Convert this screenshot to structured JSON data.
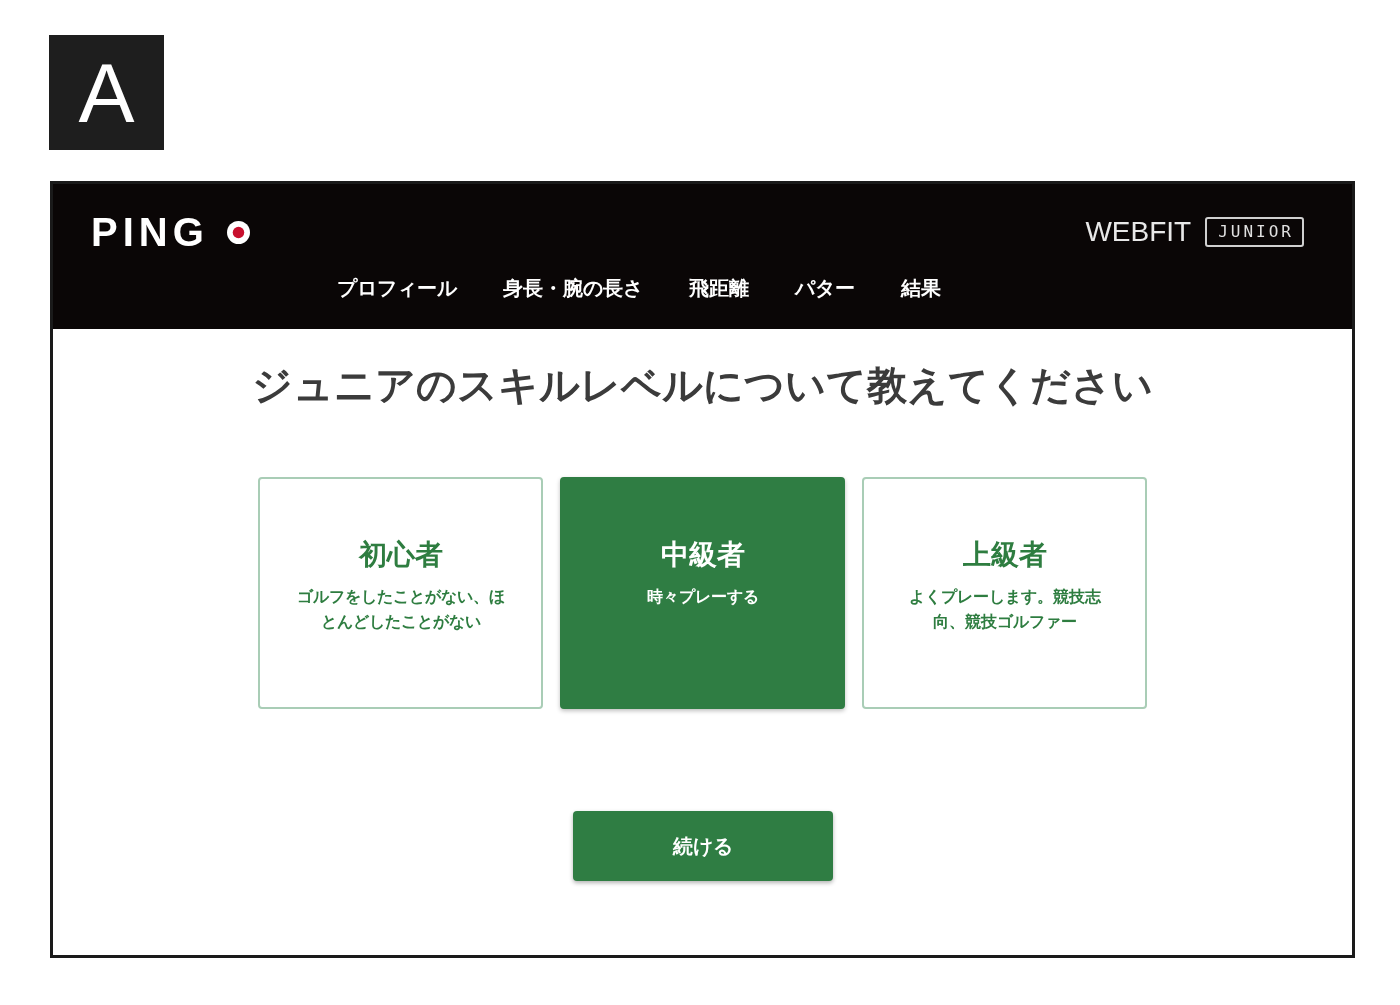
{
  "panel_label": "A",
  "header": {
    "logo": "PING",
    "product": "WEBFIT",
    "badge": "JUNIOR"
  },
  "nav": [
    "プロフィール",
    "身長・腕の長さ",
    "飛距離",
    "パター",
    "結果"
  ],
  "heading": "ジュニアのスキルレベルについて教えてください",
  "options": [
    {
      "title": "初心者",
      "description": "ゴルフをしたことがない、ほとんどしたことがない",
      "selected": false
    },
    {
      "title": "中級者",
      "description": "時々プレーする",
      "selected": true
    },
    {
      "title": "上級者",
      "description": "よくプレーします。競技志向、競技ゴルファー",
      "selected": false
    }
  ],
  "continue_button": "続ける"
}
